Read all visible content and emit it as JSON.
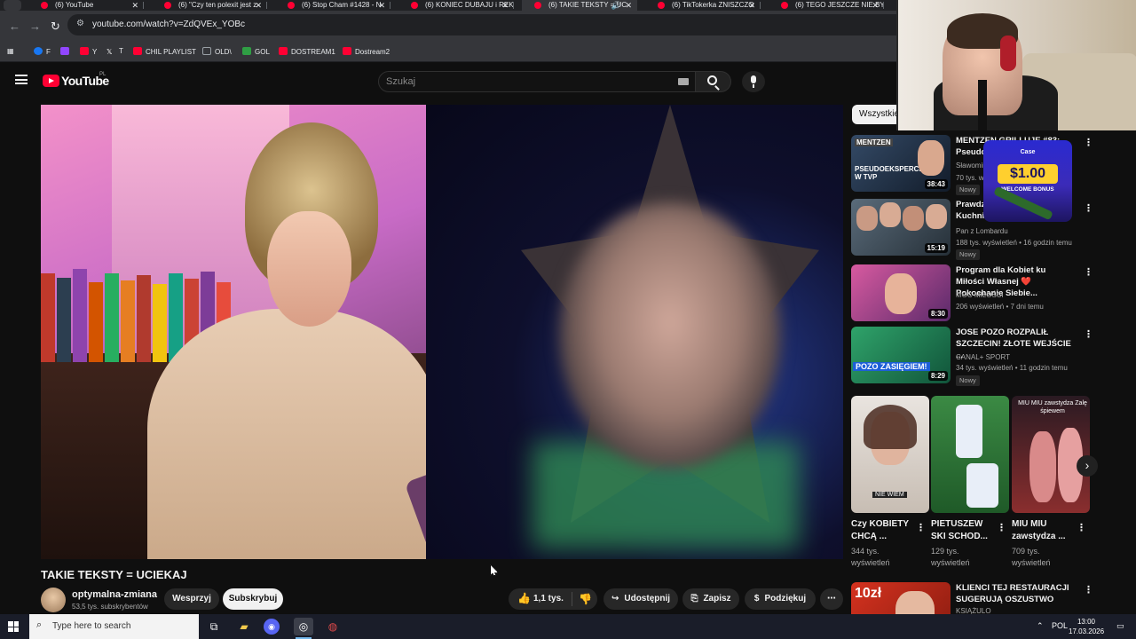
{
  "tabs": [
    {
      "label": "(6) YouTube",
      "active": false
    },
    {
      "label": "(6) \"Czy ten polexit jest z",
      "active": false
    },
    {
      "label": "(6) Stop Cham #1428 - N",
      "active": false
    },
    {
      "label": "(6) KONIEC DUBAJU i REK",
      "active": false
    },
    {
      "label": "(6) TAKIE TEKSTY = UC",
      "active": true
    },
    {
      "label": "(6) TikTokerka ZNISZCZO",
      "active": false
    },
    {
      "label": "(6) TEGO JESZCZE NIE BY",
      "active": false
    }
  ],
  "address_bar": {
    "url": "youtube.com/watch?v=ZdQVEx_YOBc"
  },
  "bookmarks": [
    {
      "label": "F",
      "icon": "facebook-icon",
      "color": "#1877f2"
    },
    {
      "label": "",
      "icon": "twitch-icon",
      "color": "#9146ff"
    },
    {
      "label": "Y",
      "icon": "youtube-icon",
      "color": "#ff0033"
    },
    {
      "label": "T",
      "icon": "x-icon",
      "color": "#ffffff"
    },
    {
      "label": "CHIL PLAYLIST",
      "icon": "youtube-icon",
      "color": "#ff0033"
    },
    {
      "label": "OLD\\",
      "icon": "folder-icon",
      "color": "#9aa0a6"
    },
    {
      "label": "GOL",
      "icon": "gol-icon",
      "color": "#2f9e44"
    },
    {
      "label": "DOSTREAM1",
      "icon": "youtube-icon",
      "color": "#ff0033"
    },
    {
      "label": "Dostream2",
      "icon": "youtube-icon",
      "color": "#ff0033"
    }
  ],
  "header": {
    "logo": "YouTube",
    "country": "PL",
    "search_placeholder": "Szukaj"
  },
  "video": {
    "title": "TAKIE TEKSTY = UCIEKAJ",
    "channel": "optymalna-zmiana",
    "subscribers": "53,5 tys. subskrybentów",
    "support_label": "Wesprzyj",
    "subscribe_label": "Subskrybuj",
    "likes": "1,1 tys.",
    "share_label": "Udostępnij",
    "save_label": "Zapisz",
    "thanks_label": "Podziękuj"
  },
  "sidebar": {
    "chip": "Wszystkie",
    "recommendations": [
      {
        "title": "MENTZEN GRILLUJE #83: Pseudoeksperci w TVP",
        "channel": "Sławomir Mentzen",
        "meta": "70 tys. wyświetleń",
        "duration": "38:43",
        "badge": "Nowy"
      },
      {
        "title": "Prawdziwe Kobiety od Kuchni 337 \"Za...",
        "channel": "Pan z Lombardu",
        "meta": "188 tys. wyświetleń • 16 godzin temu",
        "duration": "15:19",
        "badge": "Nowy"
      },
      {
        "title": "Program dla Kobiet ku Miłości Własnej ❤️ Pokochanie Siebie...",
        "channel": "MOC MIŁOŚCI",
        "meta": "206 wyświetleń • 7 dni temu",
        "duration": "8:30",
        "badge": ""
      },
      {
        "title": "JOSE POZO ROZPALIŁ SZCZECIN! ZŁOTE WEJŚCIE ...",
        "channel": "CANAL+ SPORT",
        "meta": "34 tys. wyświetleń • 11 godzin temu",
        "duration": "8:29",
        "badge": "Nowy"
      }
    ],
    "shorts": [
      {
        "title": "Czy KOBIETY CHCĄ ...",
        "views": "344 tys. wyświetleń"
      },
      {
        "title": "PIETUSZEW SKI SCHOD...",
        "views": "129 tys. wyświetleń"
      },
      {
        "title": "MIU MIU zawstydza ...",
        "views": "709 tys. wyświetleń"
      }
    ],
    "last_rec": {
      "title": "KLIENCI TEJ RESTAURACJI SUGERUJĄ OSZUSTWO",
      "channel": "KSIĄŻULO"
    }
  },
  "overlays": {
    "ad": {
      "brand": "Case",
      "amount": "$1.00",
      "text": "WELCOME BONUS"
    },
    "thumbnail_texts": [
      "MENTZEN",
      "PSEUDOEKSPERCI W TVP",
      "POZO ZASIĘGIEM!",
      "NIE WIEM",
      "10zł",
      "MIU MIU zawstydza Zalę śpiewem"
    ]
  },
  "taskbar": {
    "search_placeholder": "Type here to search",
    "language": "POL",
    "time": "13:00",
    "date": "17.03.2026"
  }
}
